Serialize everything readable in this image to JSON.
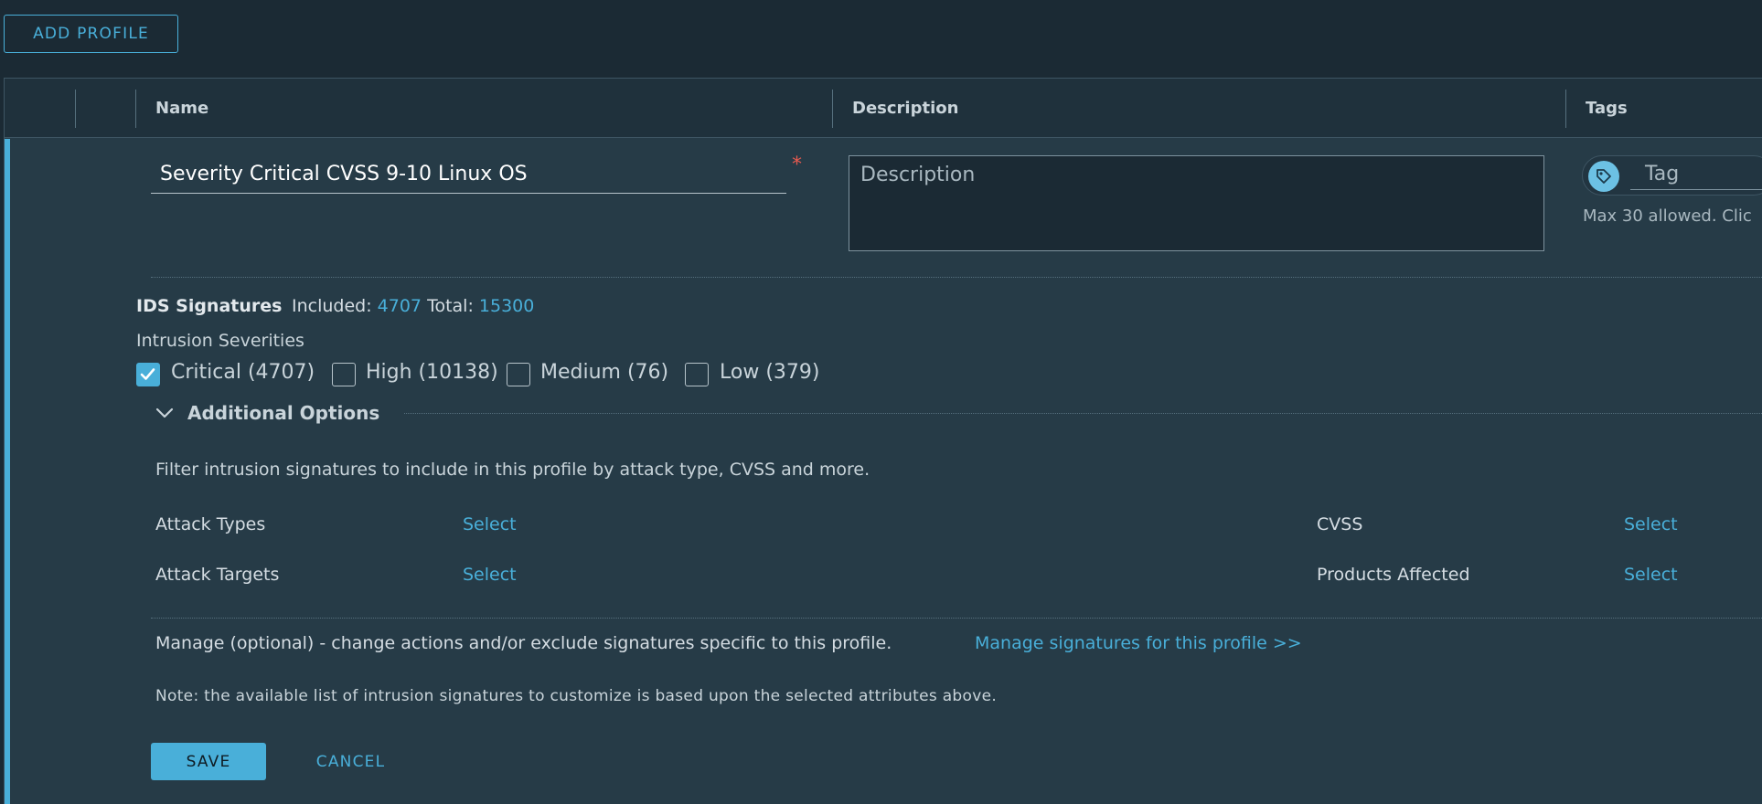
{
  "toolbar": {
    "add_profile_label": "ADD PROFILE"
  },
  "table": {
    "columns": {
      "name": "Name",
      "description": "Description",
      "tags": "Tags"
    }
  },
  "form": {
    "name_value": "Severity Critical CVSS 9-10 Linux OS",
    "required_mark": "*",
    "description_placeholder": "Description",
    "tag_placeholder": "Tag",
    "tag_hint": "Max 30 allowed. Clic"
  },
  "ids": {
    "label": "IDS Signatures",
    "included_label": "Included:",
    "included_value": "4707",
    "total_label": "Total:",
    "total_value": "15300"
  },
  "severities": {
    "title": "Intrusion Severities",
    "items": [
      {
        "label": "Critical (4707)",
        "checked": true
      },
      {
        "label": "High (10138)",
        "checked": false
      },
      {
        "label": "Medium (76)",
        "checked": false
      },
      {
        "label": "Low (379)",
        "checked": false
      }
    ]
  },
  "additional": {
    "title": "Additional Options",
    "description": "Filter intrusion signatures to include in this profile by attack type, CVSS and more.",
    "attack_types": "Attack Types",
    "attack_targets": "Attack Targets",
    "cvss": "CVSS",
    "products_affected": "Products Affected",
    "select": "Select"
  },
  "manage": {
    "text": "Manage (optional) - change actions and/or exclude signatures specific to this profile.",
    "link": "Manage signatures for this profile >>",
    "note": "Note: the available list of intrusion signatures to customize is based upon the selected attributes above."
  },
  "actions": {
    "save": "SAVE",
    "cancel": "CANCEL"
  },
  "colors": {
    "accent": "#49afd9",
    "background": "#1b2a34",
    "panel": "#263b47",
    "required": "#e85a4f"
  }
}
